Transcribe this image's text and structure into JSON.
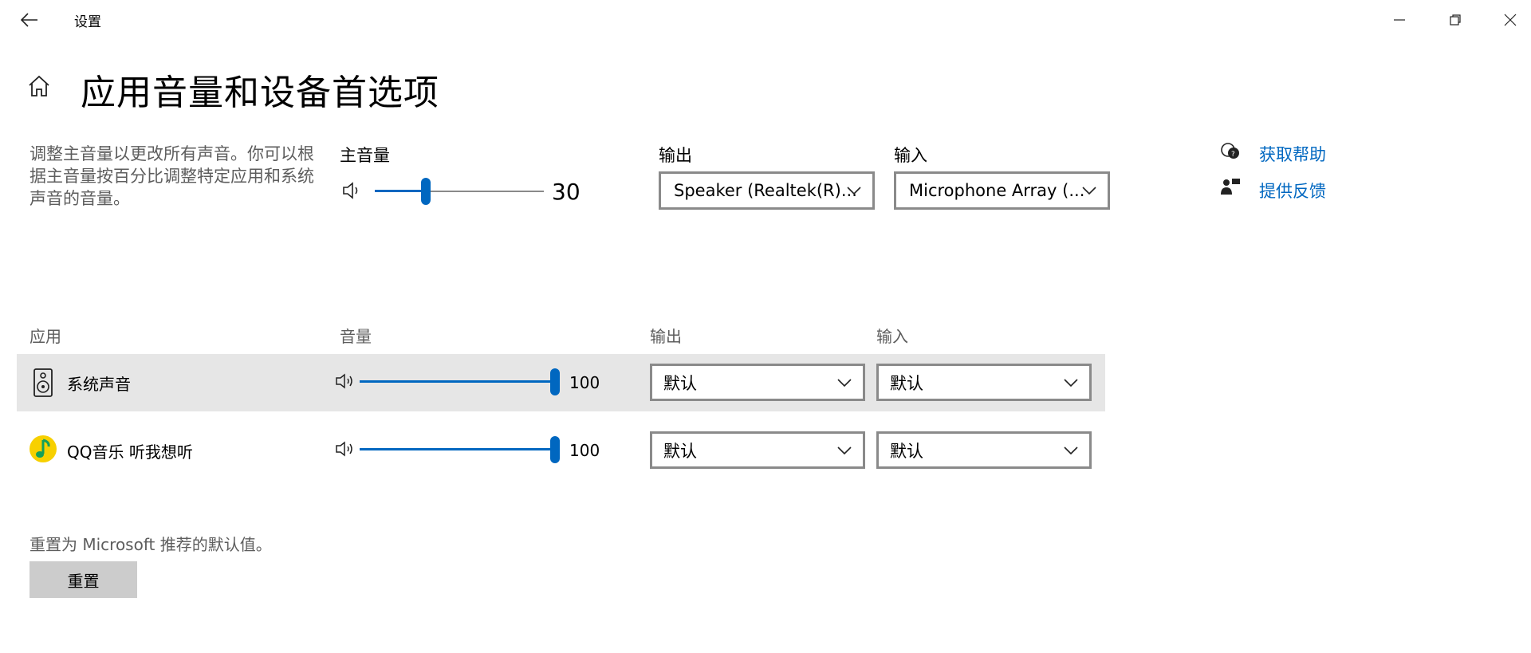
{
  "window": {
    "title": "设置",
    "back_icon": "back-arrow-icon",
    "minimize_icon": "minimize-icon",
    "restore_icon": "restore-icon",
    "close_icon": "close-icon"
  },
  "page": {
    "title": "应用音量和设备首选项",
    "home_icon": "home-icon"
  },
  "master": {
    "description": "调整主音量以更改所有声音。你可以根据主音量按百分比调整特定应用和系统声音的音量。",
    "volume_label": "主音量",
    "volume_value": "30",
    "volume_icon": "speaker-icon",
    "output_label": "输出",
    "output_value": "Speaker (Realtek(R)...",
    "input_label": "输入",
    "input_value": "Microphone Array (..."
  },
  "help": {
    "get_help": "获取帮助",
    "feedback": "提供反馈",
    "get_help_icon": "help-chat-icon",
    "feedback_icon": "feedback-icon"
  },
  "apps_table": {
    "headers": {
      "app": "应用",
      "volume": "音量",
      "output": "输出",
      "input": "输入"
    },
    "rows": [
      {
        "name": "系统声音",
        "icon": "system-sounds-icon",
        "volume": "100",
        "output": "默认",
        "input": "默认",
        "selected": true
      },
      {
        "name": "QQ音乐 听我想听",
        "icon": "qq-music-icon",
        "volume": "100",
        "output": "默认",
        "input": "默认",
        "selected": false
      }
    ]
  },
  "reset": {
    "description": "重置为 Microsoft 推荐的默认值。",
    "button": "重置"
  },
  "colors": {
    "accent": "#0067c0",
    "row_highlight": "#e6e6e6",
    "button_bg": "#cccccc",
    "secondary_text": "#5d5d5d"
  }
}
